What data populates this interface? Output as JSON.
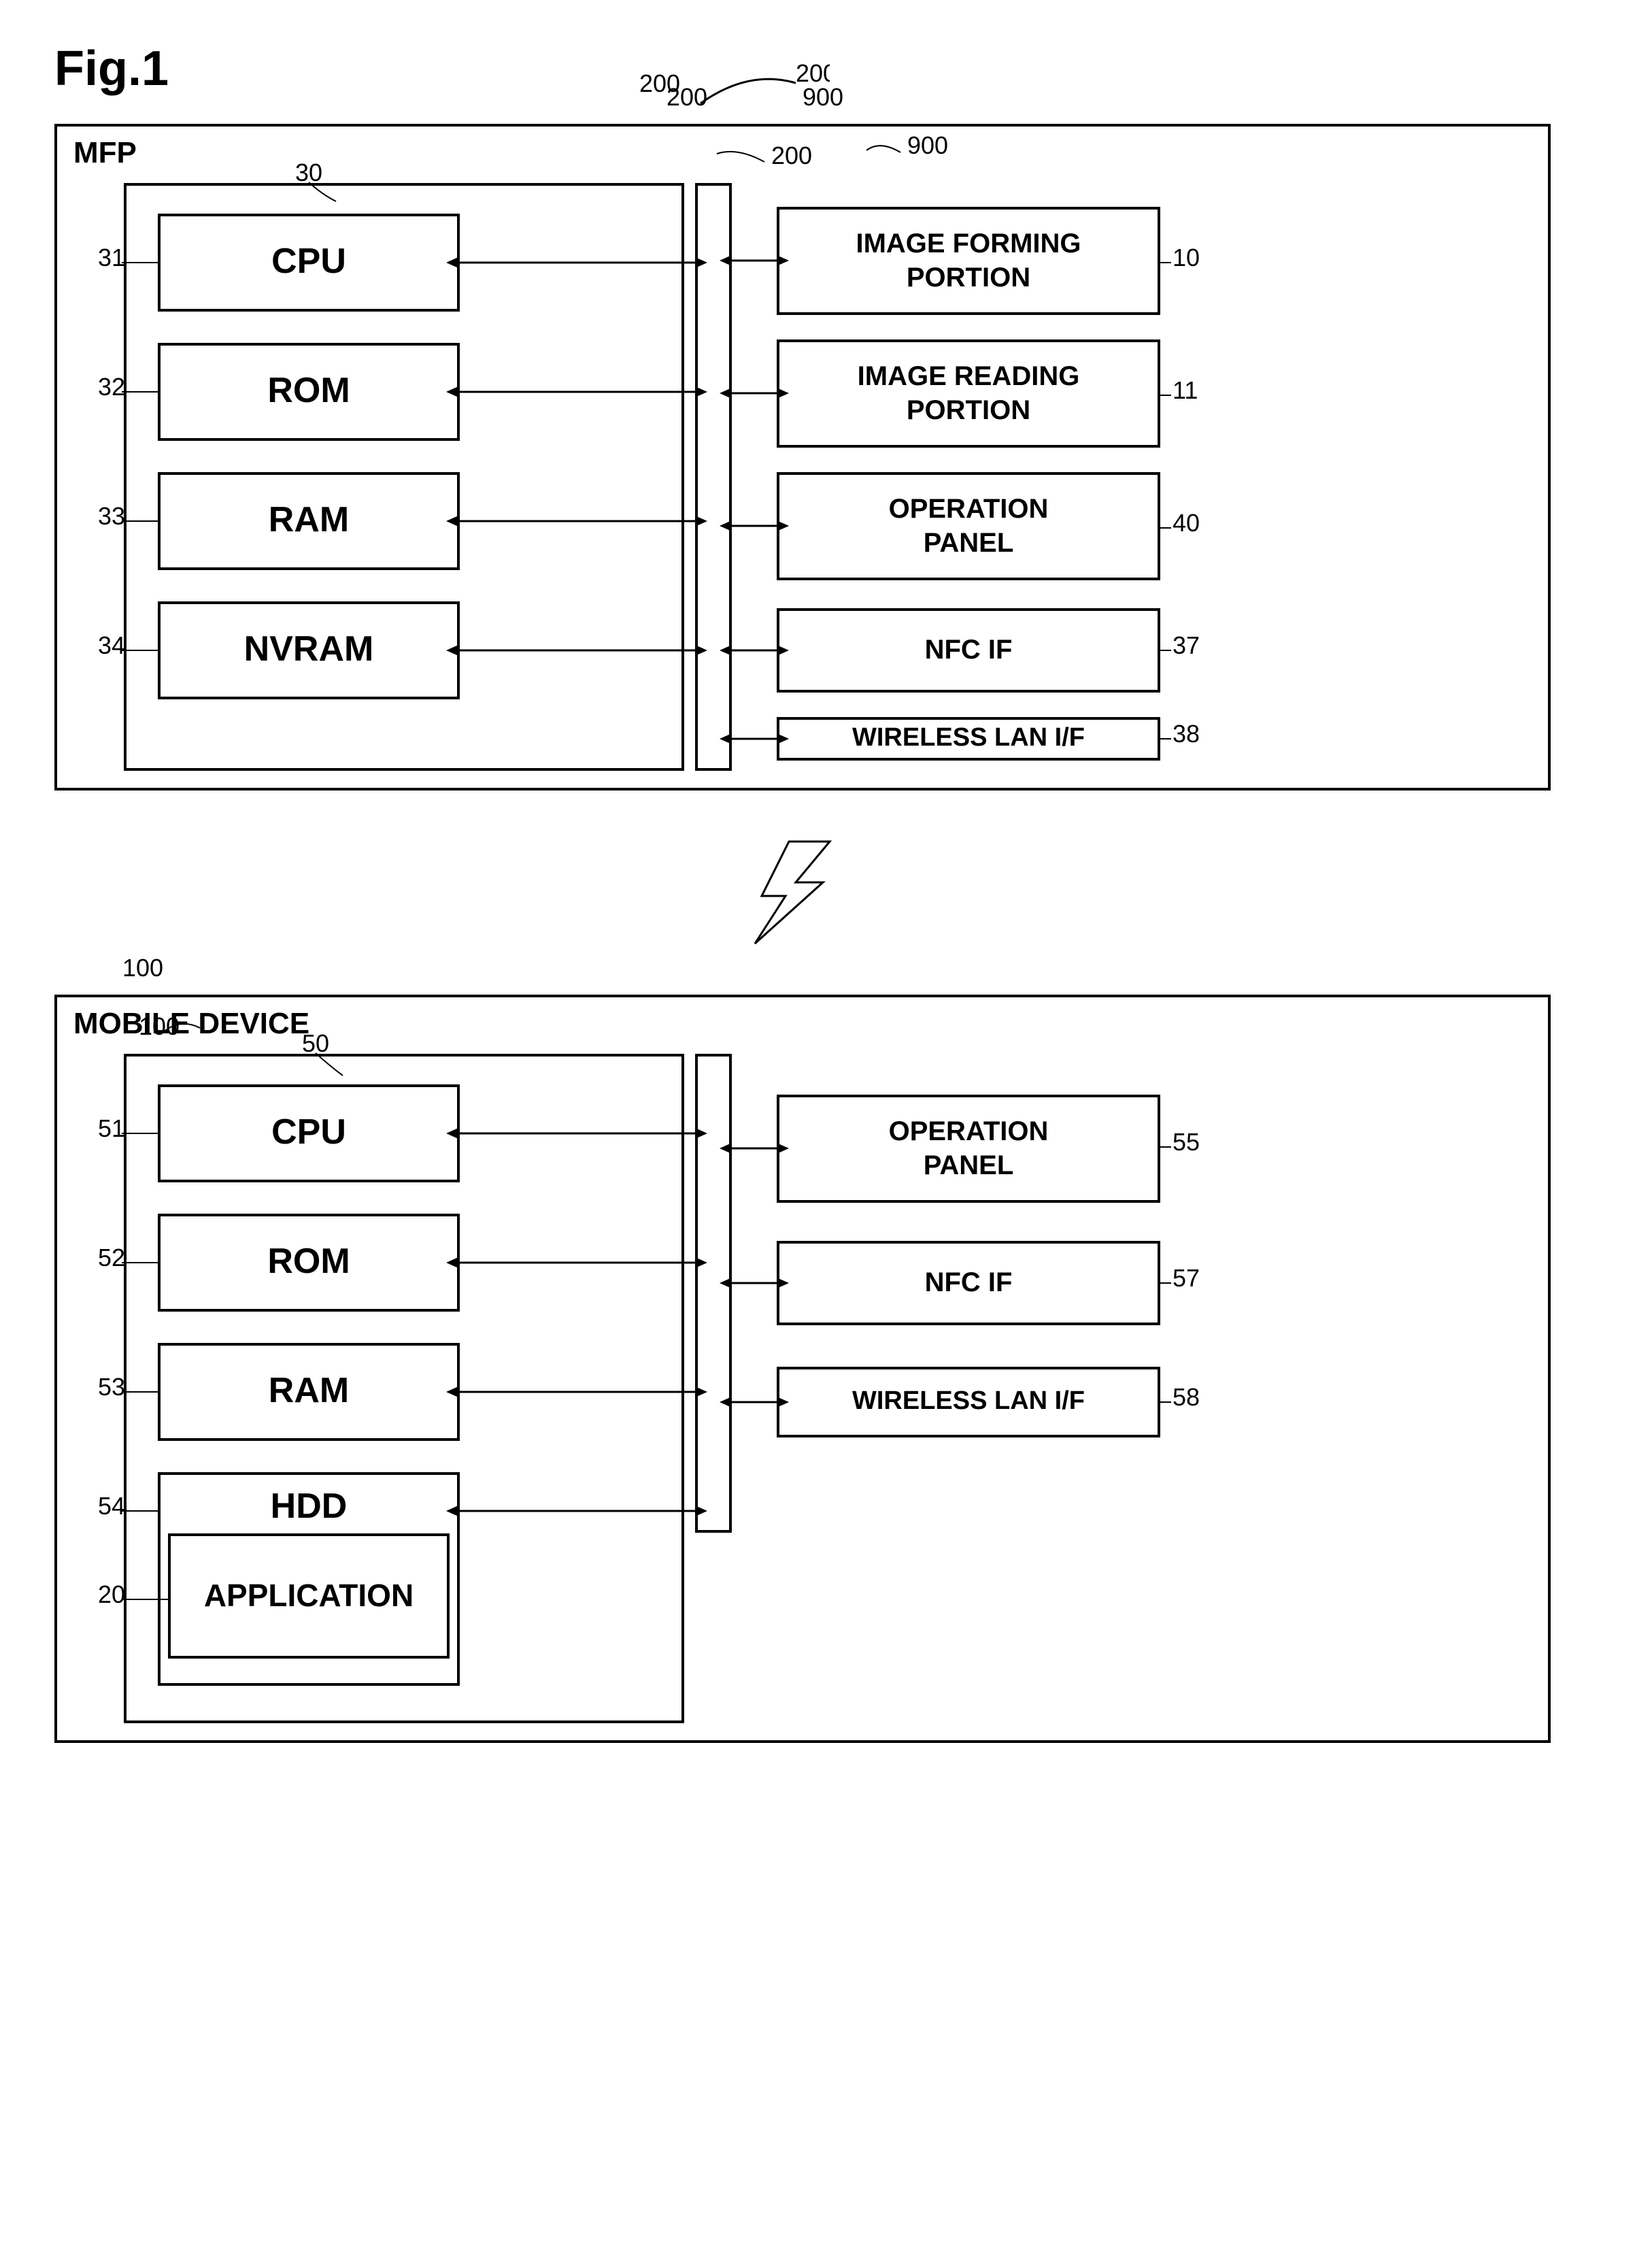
{
  "figure": {
    "title": "Fig.1",
    "mfp": {
      "label": "MFP",
      "ref": "200",
      "inner_ref": "30",
      "components": [
        {
          "label": "CPU",
          "ref": "31"
        },
        {
          "label": "ROM",
          "ref": "32"
        },
        {
          "label": "RAM",
          "ref": "33"
        },
        {
          "label": "NVRAM",
          "ref": "34"
        }
      ],
      "right_components": [
        {
          "label": "IMAGE FORMING\nPORTION",
          "ref": "10"
        },
        {
          "label": "IMAGE READING\nPORTION",
          "ref": "11"
        },
        {
          "label": "OPERATION\nPANEL",
          "ref": "40"
        },
        {
          "label": "NFC IF",
          "ref": "37"
        },
        {
          "label": "WIRELESS LAN I/F",
          "ref": "38"
        }
      ]
    },
    "mobile": {
      "label": "MOBILE DEVICE",
      "ref": "100",
      "inner_ref": "50",
      "components": [
        {
          "label": "CPU",
          "ref": "51"
        },
        {
          "label": "ROM",
          "ref": "52"
        },
        {
          "label": "RAM",
          "ref": "53"
        },
        {
          "label": "HDD",
          "ref": "54"
        },
        {
          "label": "APPLICATION",
          "ref": "20"
        }
      ],
      "right_components": [
        {
          "label": "OPERATION\nPANEL",
          "ref": "55"
        },
        {
          "label": "NFC IF",
          "ref": "57"
        },
        {
          "label": "WIRELESS LAN I/F",
          "ref": "58"
        }
      ]
    }
  }
}
